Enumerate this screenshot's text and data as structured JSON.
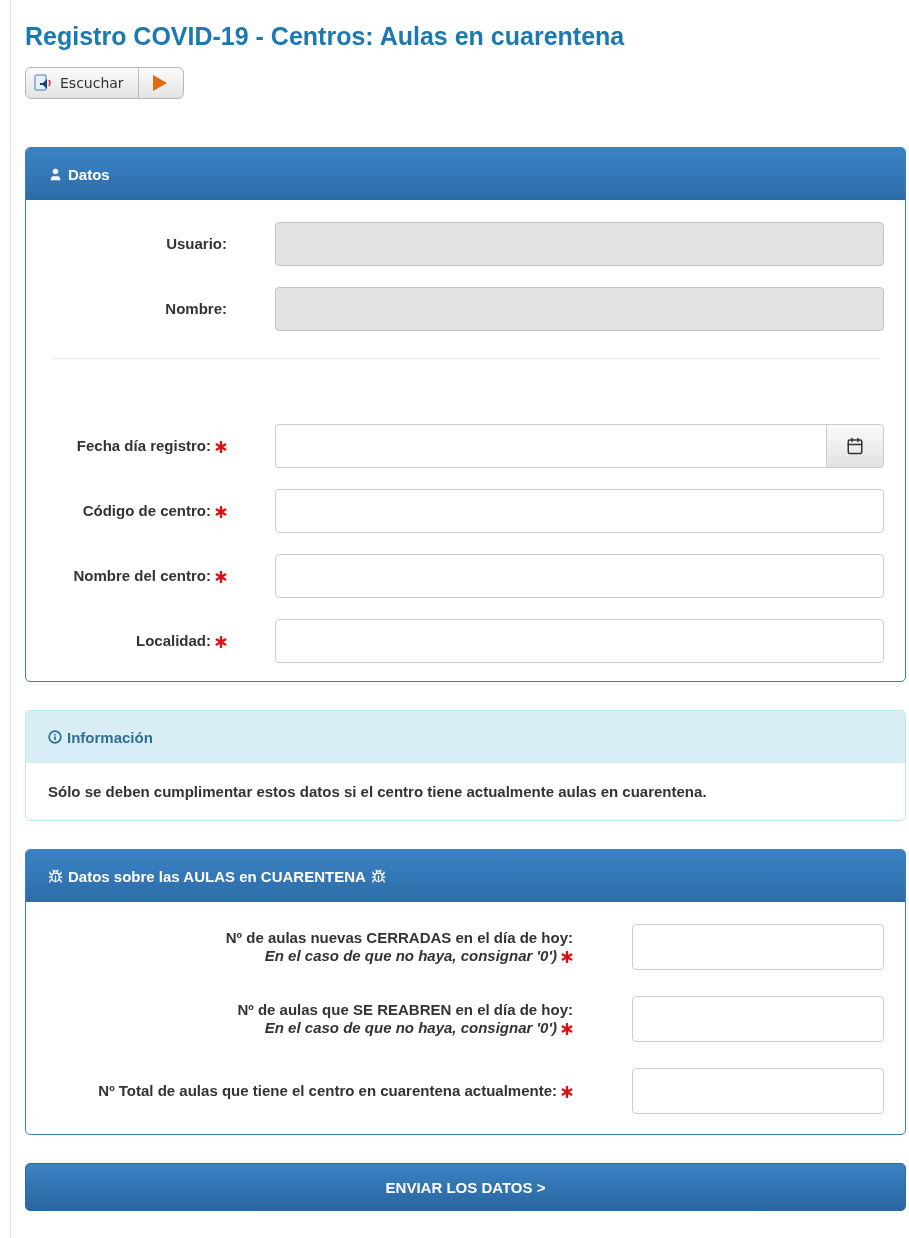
{
  "title": "Registro COVID-19 - Centros: Aulas en cuarentena",
  "listen_button": {
    "label": "Escuchar"
  },
  "datos_panel": {
    "title": "Datos",
    "fields": [
      {
        "label": "Usuario:",
        "required": false,
        "disabled": true,
        "kind": "text"
      },
      {
        "label": "Nombre:",
        "required": false,
        "disabled": true,
        "kind": "text"
      },
      {
        "kind": "divider"
      },
      {
        "label": "Fecha día registro:",
        "required": true,
        "disabled": false,
        "kind": "date"
      },
      {
        "label": "Código de centro:",
        "required": true,
        "disabled": false,
        "kind": "text"
      },
      {
        "label": "Nombre del centro:",
        "required": true,
        "disabled": false,
        "kind": "text"
      },
      {
        "label": "Localidad:",
        "required": true,
        "disabled": false,
        "kind": "text"
      }
    ]
  },
  "info_panel": {
    "title": "Información",
    "message": "Sólo se deben cumplimentar estos datos si el centro tiene actualmente aulas en cuarentena."
  },
  "aulas_panel": {
    "title": "Datos sobre las AULAS en CUARENTENA",
    "fields": [
      {
        "label": "Nº de aulas nuevas CERRADAS en el día de hoy:",
        "hint": "En el caso de que no haya, consignar '0')",
        "required": true
      },
      {
        "label": "Nº de aulas que SE REABREN en el día de hoy:",
        "hint": "En el caso de que no haya, consignar '0')",
        "required": true
      },
      {
        "label": "Nº Total de aulas que tiene el centro en cuarentena actualmente:",
        "required": true
      }
    ]
  },
  "submit_button": {
    "label": "ENVIAR LOS DATOS >"
  }
}
